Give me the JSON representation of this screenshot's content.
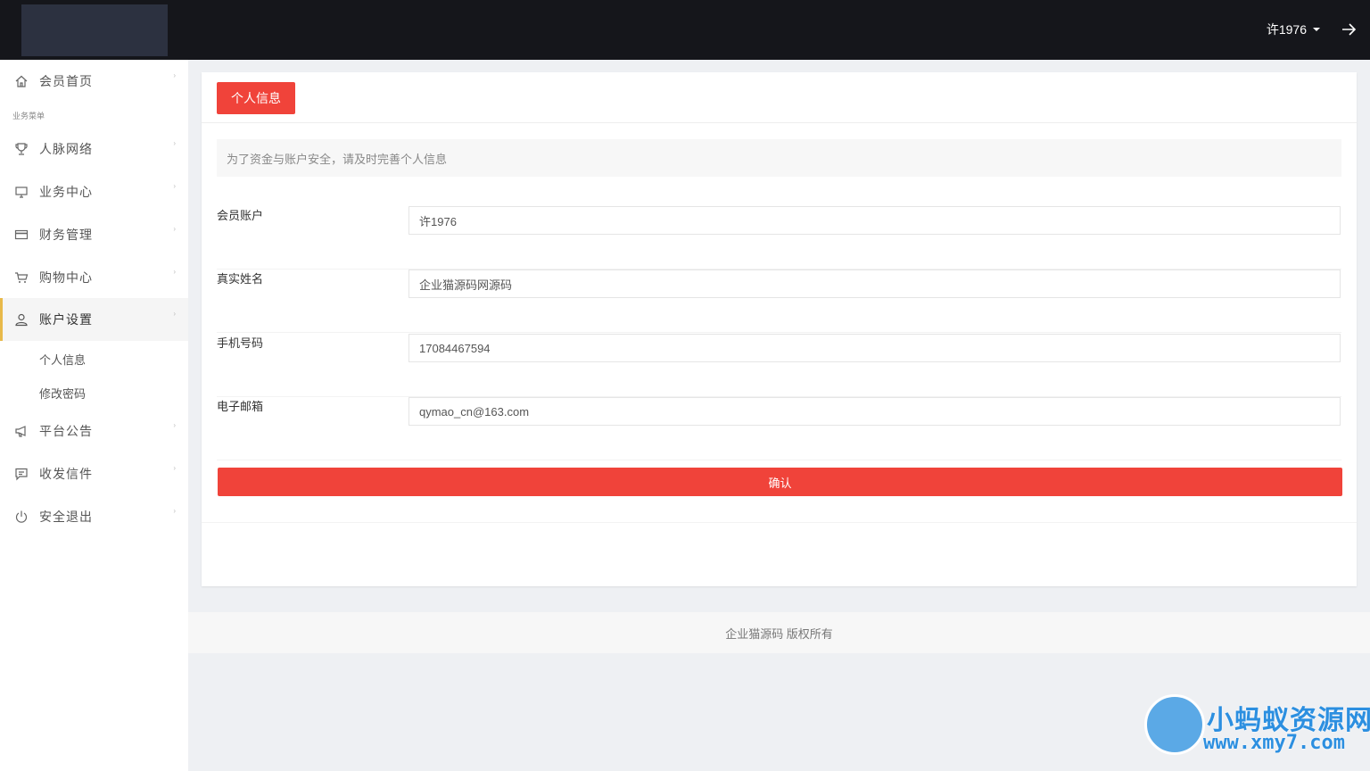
{
  "header": {
    "username": "许1976"
  },
  "sidebar": {
    "items": [
      {
        "label": "会员首页",
        "icon": "home-icon"
      },
      {
        "label": "人脉网络",
        "icon": "trophy-icon"
      },
      {
        "label": "业务中心",
        "icon": "monitor-icon"
      },
      {
        "label": "财务管理",
        "icon": "card-icon"
      },
      {
        "label": "购物中心",
        "icon": "cart-icon"
      },
      {
        "label": "账户设置",
        "icon": "user-icon"
      },
      {
        "label": "平台公告",
        "icon": "megaphone-icon"
      },
      {
        "label": "收发信件",
        "icon": "message-icon"
      },
      {
        "label": "安全退出",
        "icon": "power-icon"
      }
    ],
    "section_label": "业务菜单",
    "sub_items": [
      {
        "label": "个人信息"
      },
      {
        "label": "修改密码"
      }
    ]
  },
  "card": {
    "tab_label": "个人信息",
    "notice": "为了资金与账户安全，请及时完善个人信息",
    "fields": [
      {
        "label": "会员账户",
        "value": "许1976"
      },
      {
        "label": "真实姓名",
        "value": "企业猫源码网源码"
      },
      {
        "label": "手机号码",
        "value": "17084467594"
      },
      {
        "label": "电子邮箱",
        "value": "qymao_cn@163.com"
      }
    ],
    "confirm_label": "确认"
  },
  "footer": {
    "text": "企业猫源码 版权所有"
  },
  "watermark": {
    "title": "小蚂蚁资源网",
    "url": "www.xmy7.com"
  },
  "colors": {
    "topbar": "#15161b",
    "accent_red": "#f0433a",
    "active_border": "#e8b94a",
    "watermark_blue": "#2c8fe0"
  }
}
